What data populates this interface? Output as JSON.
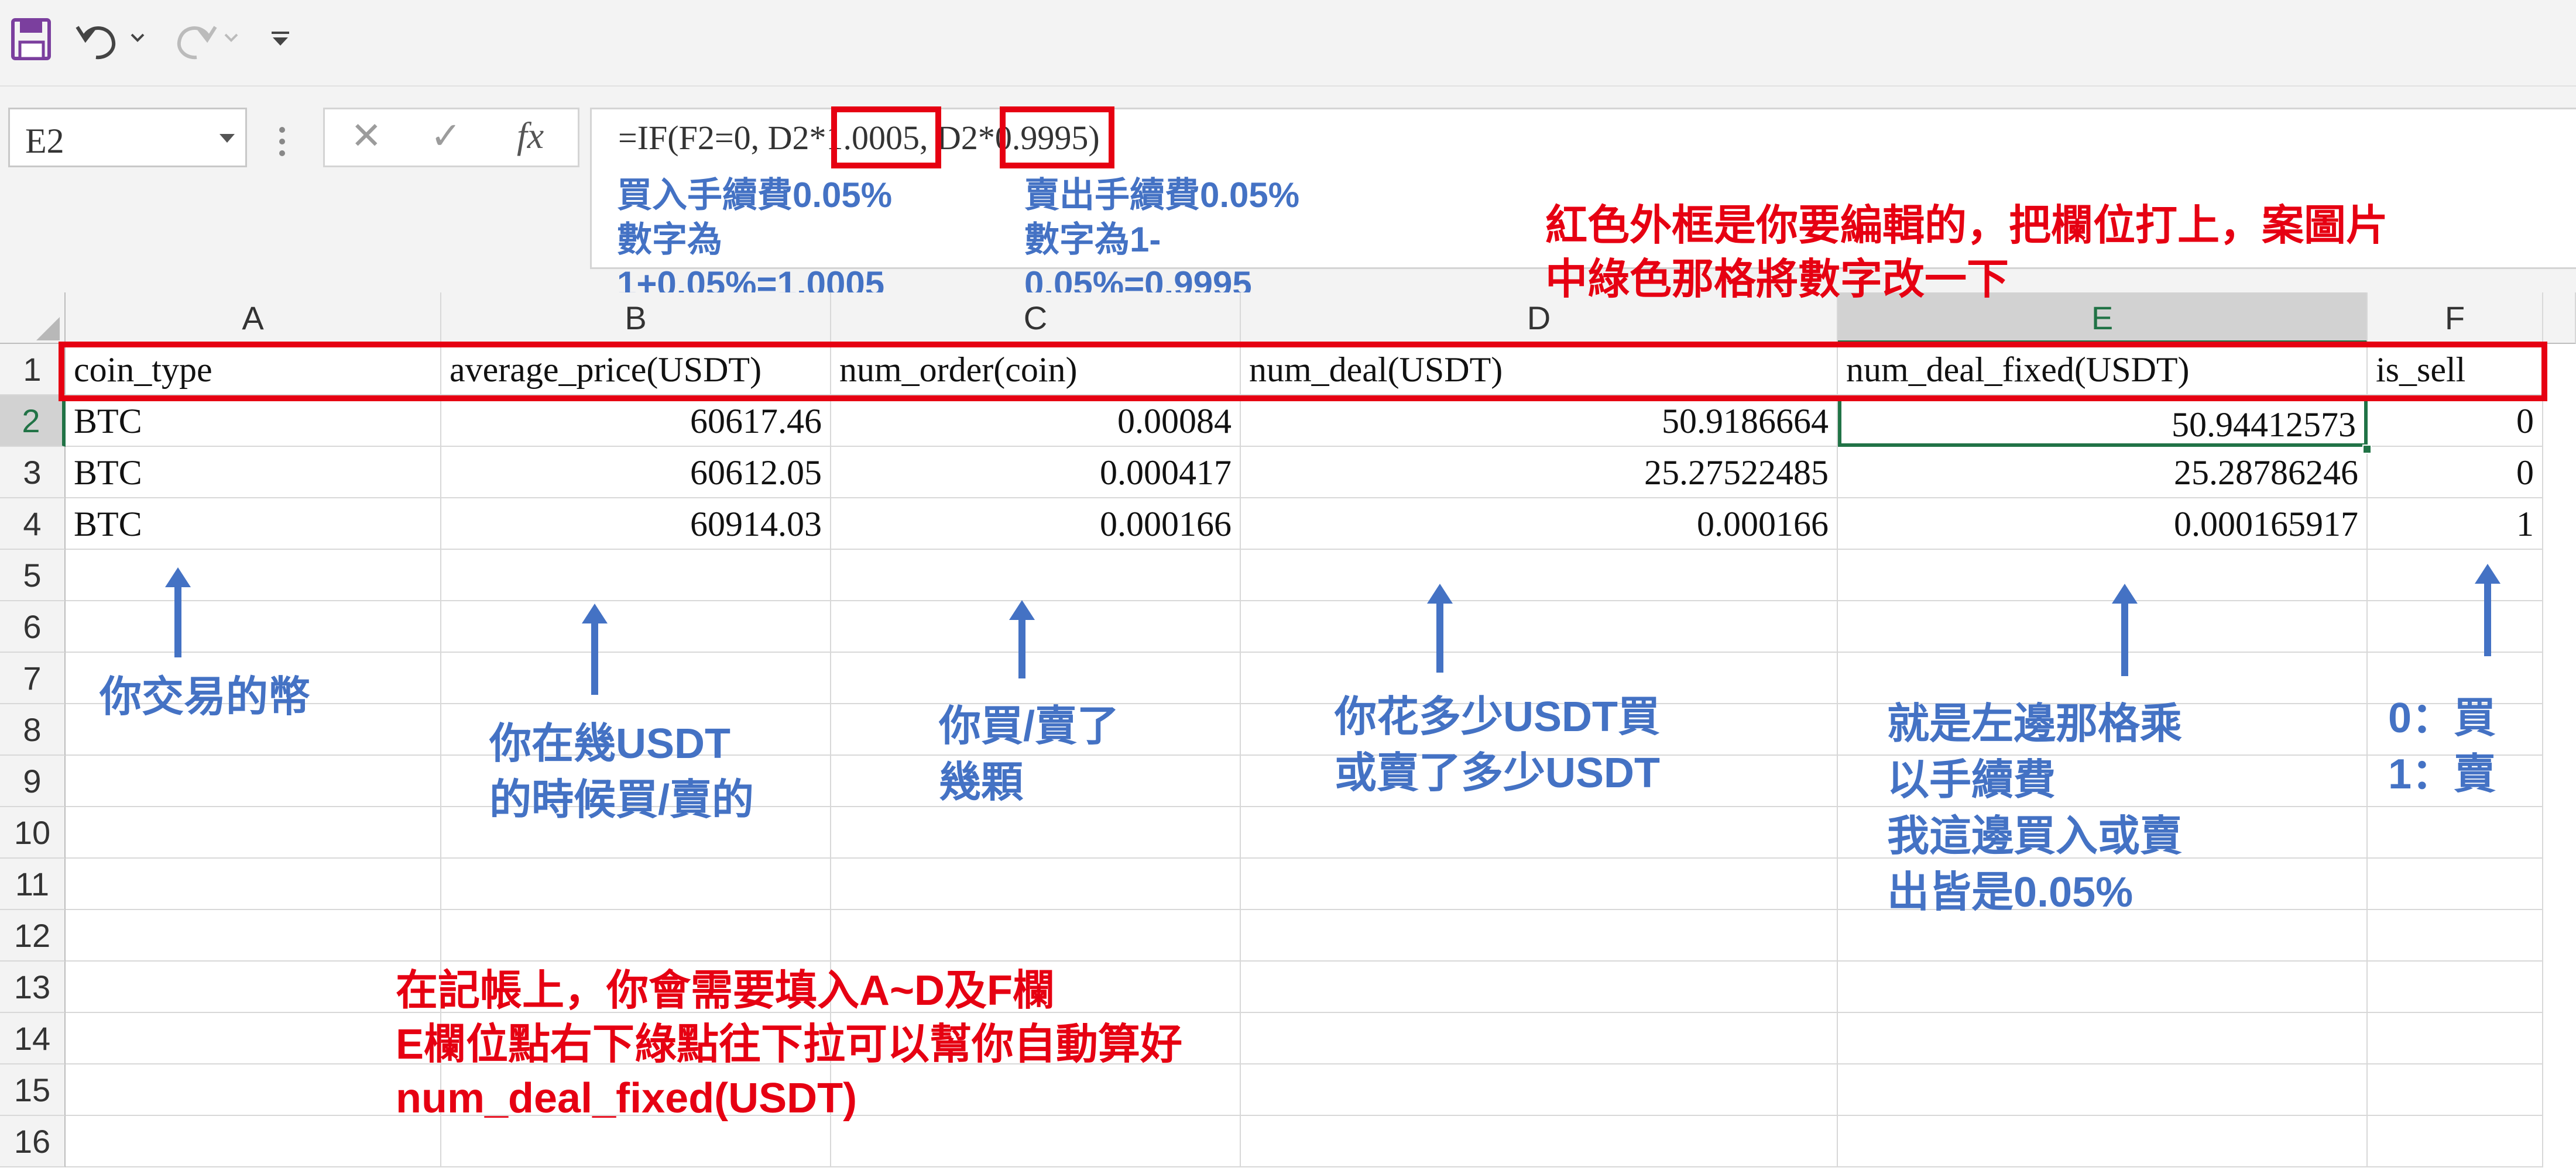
{
  "toolbar": {
    "icons": [
      "save-icon",
      "undo-icon",
      "redo-icon",
      "customize-icon"
    ]
  },
  "formula_bar": {
    "name_box": "E2",
    "cancel_symbol": "✕",
    "enter_symbol": "✓",
    "fx_symbol": "fx",
    "formula_part1": "=IF(F2=0, D2*",
    "formula_box1": "1.0005",
    "formula_part2": ", D2*",
    "formula_box2": "0.9995",
    "formula_part3": ")"
  },
  "annotations": {
    "buy_fee": "買入手續費0.05%\n數字為\n1+0.05%=1.0005",
    "sell_fee": "賣出手續費0.05%\n數字為1-\n0.05%=0.9995",
    "edit_note": "紅色外框是你要編輯的，把欄位打上，案圖片\n中綠色那格將數字改一下",
    "col_a": "你交易的幣",
    "col_b": "你在幾USDT\n的時候買/賣的",
    "col_c": "你買/賣了\n幾顆",
    "col_d": "你花多少USDT買\n或賣了多少USDT",
    "col_e": "就是左邊那格乘\n以手續費\n我這邊買入或賣\n出皆是0.05%",
    "col_f": "0：買\n1：賣",
    "bottom_note": "在記帳上，你會需要填入A~D及F欄\nE欄位點右下綠點往下拉可以幫你自動算好\nnum_deal_fixed(USDT)"
  },
  "columns": [
    "A",
    "B",
    "C",
    "D",
    "E",
    "F"
  ],
  "rows": [
    "1",
    "2",
    "3",
    "4",
    "5",
    "6",
    "7",
    "8",
    "9",
    "10",
    "11",
    "12",
    "13",
    "14",
    "15",
    "16"
  ],
  "header_row": [
    "coin_type",
    "average_price(USDT)",
    "num_order(coin)",
    "num_deal(USDT)",
    "num_deal_fixed(USDT)",
    "is_sell"
  ],
  "data_rows": [
    [
      "BTC",
      "60617.46",
      "0.00084",
      "50.9186664",
      "50.94412573",
      "0"
    ],
    [
      "BTC",
      "60612.05",
      "0.000417",
      "25.27522485",
      "25.28786246",
      "0"
    ],
    [
      "BTC",
      "60914.03",
      "0.000166",
      "0.000166",
      "0.000165917",
      "1"
    ]
  ],
  "colors": {
    "red": "#e60012",
    "blue": "#4472c4",
    "excel_green": "#217346"
  }
}
